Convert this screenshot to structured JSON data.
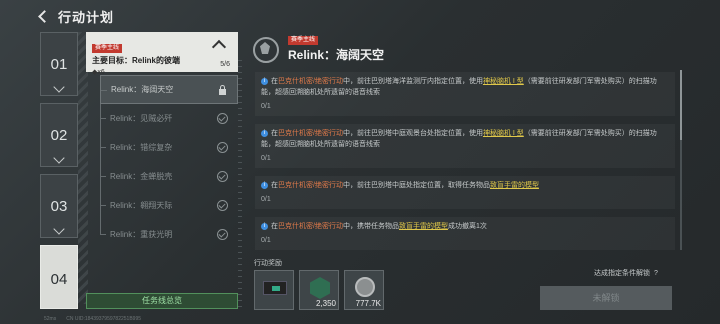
{
  "header": {
    "title": "行动计划"
  },
  "chapters": [
    {
      "num": "01",
      "active": false
    },
    {
      "num": "02",
      "active": false
    },
    {
      "num": "03",
      "active": false
    },
    {
      "num": "04",
      "active": true
    }
  ],
  "main_goal": {
    "tag": "赛季主线",
    "title": "主要目标：Relink的彼端",
    "reward_count": "◆x6",
    "progress": "5/6"
  },
  "sub_items": [
    {
      "label": "Relink：海阔天空",
      "state": "locked"
    },
    {
      "label": "Relink：见贼必歼",
      "state": "done"
    },
    {
      "label": "Relink：错综复杂",
      "state": "done"
    },
    {
      "label": "Relink：金蝉脱壳",
      "state": "done"
    },
    {
      "label": "Relink：翱翔天际",
      "state": "done"
    },
    {
      "label": "Relink：重获光明",
      "state": "done"
    }
  ],
  "overview_button": "任务线总览",
  "footer": {
    "ping": "52ms",
    "uid": "CN UID:1843937959782251B995"
  },
  "detail": {
    "tag": "赛季主线",
    "title": "Relink：海阔天空"
  },
  "tasks": [
    {
      "pre": "在",
      "org": "巴克什机密/绝密行动",
      "mid": "中，前往巴别塔海洋监测厅内指定位置，使用",
      "item": "神秘脑机 I 型",
      "post": "（需要前往研发部门军需处购买）的扫描功能，超感回溯脑机处所遗留的语音线索",
      "count": "0/1"
    },
    {
      "pre": "在",
      "org": "巴克什机密/绝密行动",
      "mid": "中，前往巴别塔中庭观景台处指定位置，使用",
      "item": "神秘脑机 I 型",
      "post": "（需要前往研发部门军需处购买）的扫描功能，超感回溯脑机处所遗留的语音线索",
      "count": "0/1"
    },
    {
      "pre": "在",
      "org": "巴克什机密/绝密行动",
      "mid": "中，前往巴别塔中庭处指定位置，取得任务物品",
      "item": "致盲手雷的模型",
      "post": "",
      "count": "0/1"
    },
    {
      "pre": "在",
      "org": "巴克什机密/绝密行动",
      "mid": "中，携带任务物品",
      "item": "致盲手雷的模型",
      "post": "成功撤离1次",
      "count": "0/1"
    }
  ],
  "rewards_label": "行动奖励",
  "rewards": [
    {
      "icon": "case-icon",
      "amount": ""
    },
    {
      "icon": "chip-icon",
      "amount": "2,350"
    },
    {
      "icon": "coin-icon",
      "amount": "777.7K"
    }
  ],
  "unlock_condition": "达成指定条件解锁",
  "unlock_button": "未解锁",
  "colors": {
    "accent_green": "#52905c",
    "tag_red": "#c23a2f",
    "org_orange": "#e07a4a",
    "item_yellow": "#e0c84a"
  }
}
